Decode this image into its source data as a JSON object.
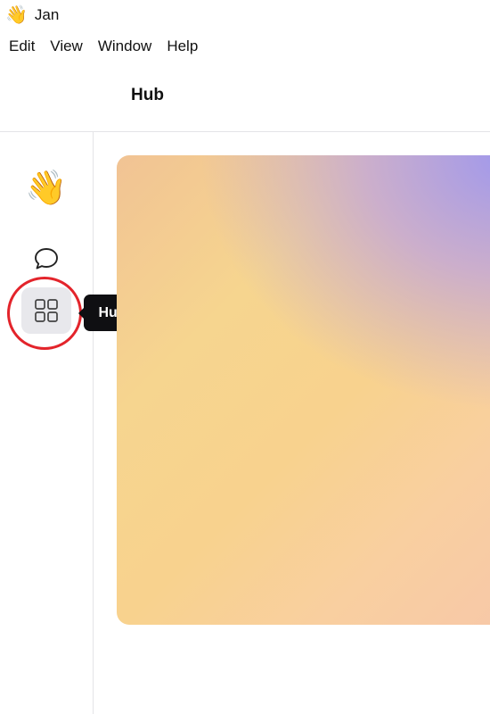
{
  "title_bar": {
    "emoji": "👋",
    "title": "Jan"
  },
  "menu": {
    "items": [
      "Edit",
      "View",
      "Window",
      "Help"
    ]
  },
  "header": {
    "title": "Hub"
  },
  "sidebar": {
    "items": [
      {
        "name": "wave-emoji",
        "glyph": "👋"
      },
      {
        "name": "chat-icon"
      },
      {
        "name": "grid-icon",
        "active": true
      }
    ]
  },
  "tooltip": {
    "text": "Hub"
  },
  "colors": {
    "highlight_ring": "#e3242b",
    "tooltip_bg": "#0f0f12",
    "active_item_bg": "#e8e8ec",
    "hero_gradient": [
      "#a098ec",
      "#f6d58f",
      "#f7c8a8"
    ]
  }
}
